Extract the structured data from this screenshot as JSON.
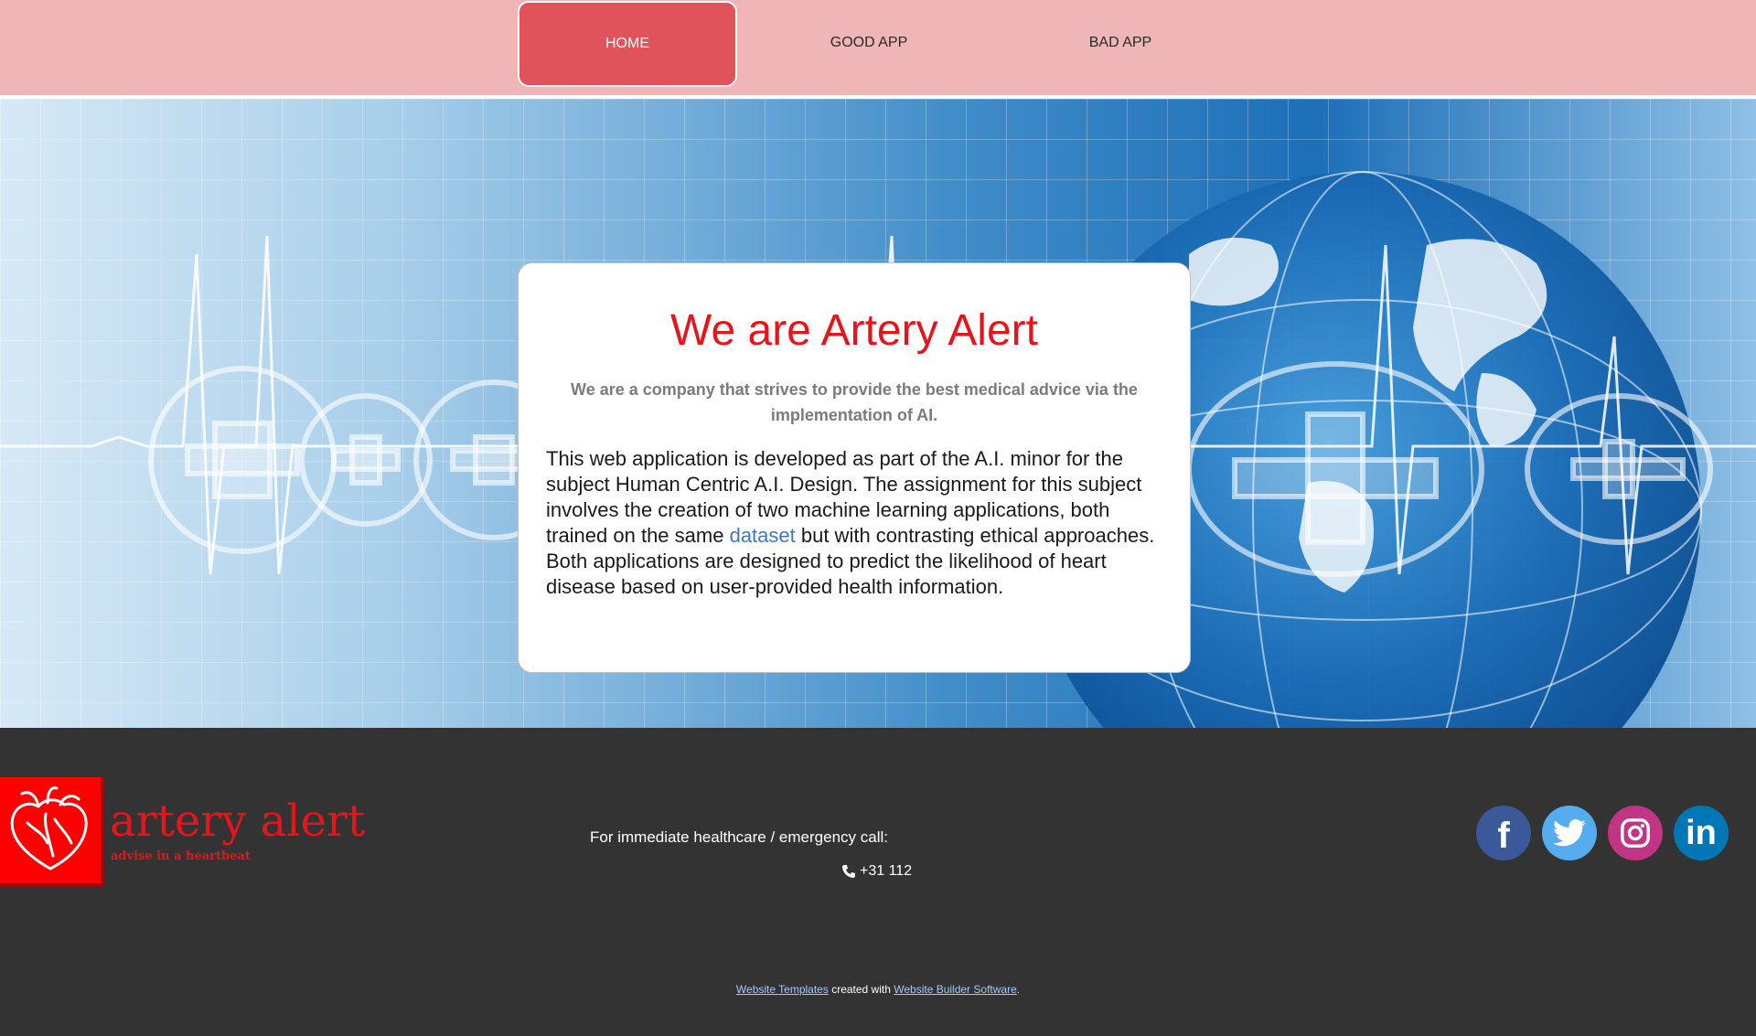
{
  "nav": {
    "items": [
      {
        "label": "HOME",
        "active": true
      },
      {
        "label": "GOOD APP",
        "active": false
      },
      {
        "label": "BAD APP",
        "active": false
      }
    ]
  },
  "hero": {
    "title": "We are Artery Alert",
    "subtitle": "We are a company that strives to provide the best medical advice via the implementation of AI.",
    "body_before_link": "This web application is developed as part of the A.I. minor for the subject Human Centric A.I. Design. The assignment for this subject involves the creation of two machine learning applications, both trained on the same ",
    "body_link": "dataset",
    "body_after_link": " but with contrasting ethical approaches. Both applications are designed to predict the likelihood of heart disease based on user-provided health information."
  },
  "footer": {
    "logo": {
      "name": "artery alert",
      "tagline": "advise in a heartbeat",
      "icon": "heart-icon"
    },
    "emergency_text": "For immediate healthcare / emergency call:",
    "phone": "+31 112",
    "phone_icon": "phone-icon",
    "socials": [
      {
        "name": "facebook",
        "icon": "facebook-icon",
        "glyph": "f",
        "color": "#3b5998"
      },
      {
        "name": "twitter",
        "icon": "twitter-icon",
        "glyph": "",
        "color": "#55acee"
      },
      {
        "name": "instagram",
        "icon": "instagram-icon",
        "glyph": "",
        "color": "#c13584"
      },
      {
        "name": "linkedin",
        "icon": "linkedin-icon",
        "glyph": "in",
        "color": "#0077b5"
      }
    ],
    "credits": {
      "link1": "Website Templates",
      "middle": " created with ",
      "link2": "Website Builder Software",
      "end": "."
    }
  },
  "colors": {
    "nav_bg": "#f0b5b6",
    "nav_active": "#e0535a",
    "title_red": "#e8141c",
    "footer_bg": "#333333",
    "link_blue": "#3e77c3"
  }
}
